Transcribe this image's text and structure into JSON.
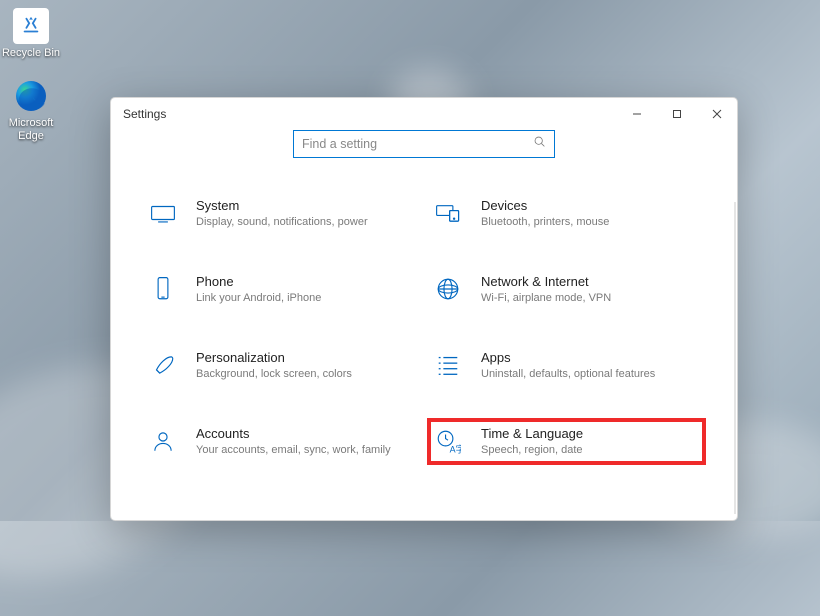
{
  "desktop": {
    "recycle_bin": "Recycle Bin",
    "edge": "Microsoft Edge"
  },
  "window": {
    "title": "Settings",
    "search_placeholder": "Find a setting"
  },
  "categories": [
    {
      "id": "system",
      "name": "System",
      "desc": "Display, sound, notifications, power"
    },
    {
      "id": "devices",
      "name": "Devices",
      "desc": "Bluetooth, printers, mouse"
    },
    {
      "id": "phone",
      "name": "Phone",
      "desc": "Link your Android, iPhone"
    },
    {
      "id": "network",
      "name": "Network & Internet",
      "desc": "Wi-Fi, airplane mode, VPN"
    },
    {
      "id": "personal",
      "name": "Personalization",
      "desc": "Background, lock screen, colors"
    },
    {
      "id": "apps",
      "name": "Apps",
      "desc": "Uninstall, defaults, optional features"
    },
    {
      "id": "accounts",
      "name": "Accounts",
      "desc": "Your accounts, email, sync, work, family"
    },
    {
      "id": "time",
      "name": "Time & Language",
      "desc": "Speech, region, date"
    }
  ],
  "highlight": "time"
}
